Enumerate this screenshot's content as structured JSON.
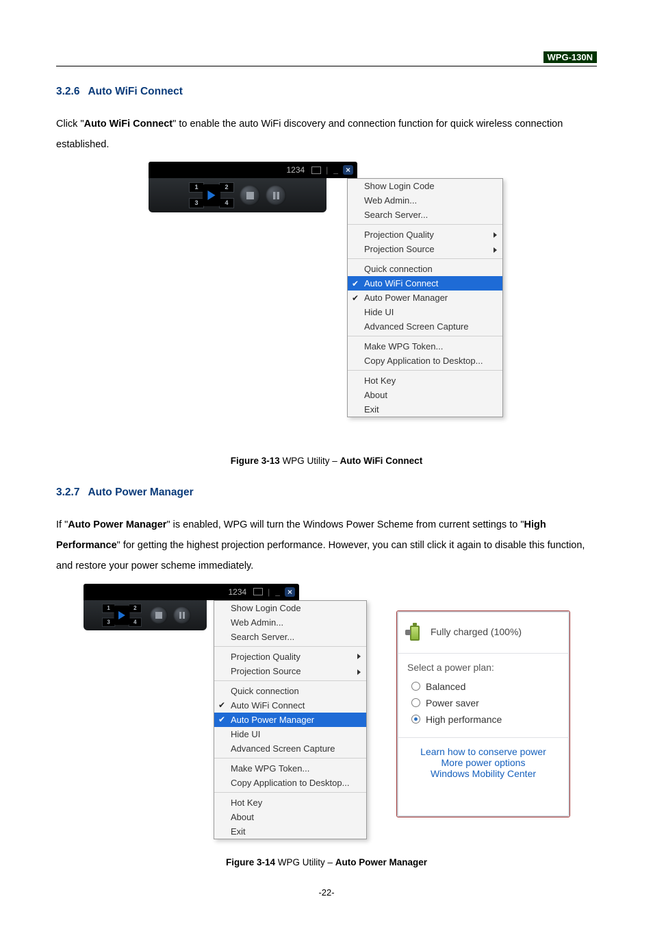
{
  "header": {
    "product": "WPG-130N"
  },
  "sections": {
    "s326": {
      "num": "3.2.6",
      "title": "Auto WiFi Connect"
    },
    "s327": {
      "num": "3.2.7",
      "title": "Auto Power Manager"
    }
  },
  "paras": {
    "p1_lead": "Click \"",
    "p1_bold": "Auto WiFi Connect",
    "p1_tail": "\" to enable the auto WiFi discovery and connection function for quick wireless connection established.",
    "p2_a": "If \"",
    "p2_b": "Auto Power Manager",
    "p2_c": "\" is enabled, WPG will turn the Windows Power Scheme from current settings to \"",
    "p2_d": "High Performance",
    "p2_e": "\" for getting the highest projection performance. However, you can still click it again to disable this function, and restore your power scheme immediately."
  },
  "captions": {
    "c1_a": "Figure 3-13",
    "c1_b": " WPG Utility – ",
    "c1_c": "Auto WiFi Connect",
    "c2_a": "Figure 3-14",
    "c2_b": " WPG Utility – ",
    "c2_c": "Auto Power Manager"
  },
  "topbar": {
    "login": "1234",
    "min": "_",
    "close": "×"
  },
  "grid": {
    "q1": "1",
    "q2": "2",
    "q3": "3",
    "q4": "4"
  },
  "menu": {
    "show_login": "Show Login Code",
    "web_admin": "Web Admin...",
    "search_server": "Search Server...",
    "proj_quality": "Projection Quality",
    "proj_source": "Projection Source",
    "quick_conn": "Quick connection",
    "auto_wifi": "Auto WiFi Connect",
    "auto_power": "Auto Power Manager",
    "hide_ui": "Hide UI",
    "adv_capture": "Advanced Screen Capture",
    "make_token": "Make WPG Token...",
    "copy_desktop": "Copy Application to Desktop...",
    "hotkey": "Hot Key",
    "about": "About",
    "exit": "Exit",
    "check": "✔"
  },
  "power": {
    "charged": "Fully charged (100%)",
    "select": "Select a power plan:",
    "balanced": "Balanced",
    "saver": "Power saver",
    "high": "High performance",
    "learn": "Learn how to conserve power",
    "more": "More power options",
    "mobility": "Windows Mobility Center"
  },
  "page_number": "-22-"
}
